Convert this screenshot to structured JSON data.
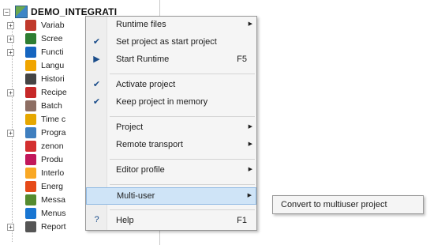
{
  "tree": {
    "root_label": "DEMO_INTEGRATI",
    "items": [
      {
        "label": "Variab",
        "icon": "variables-icon",
        "expandable": true,
        "color": "#c0392b"
      },
      {
        "label": "Scree",
        "icon": "screens-icon",
        "expandable": true,
        "color": "#2e7d32"
      },
      {
        "label": "Functi",
        "icon": "functions-icon",
        "expandable": true,
        "color": "#1565c0"
      },
      {
        "label": "Langu",
        "icon": "languages-icon",
        "expandable": false,
        "color": "#f0a500"
      },
      {
        "label": "Histori",
        "icon": "historian-icon",
        "expandable": false,
        "color": "#444444"
      },
      {
        "label": "Recipe",
        "icon": "recipes-icon",
        "expandable": true,
        "color": "#c62828"
      },
      {
        "label": "Batch",
        "icon": "batch-icon",
        "expandable": false,
        "color": "#8d6e63"
      },
      {
        "label": "Time c",
        "icon": "time-control-icon",
        "expandable": false,
        "color": "#e6a700"
      },
      {
        "label": "Progra",
        "icon": "programming-icon",
        "expandable": true,
        "color": "#3f7fbf"
      },
      {
        "label": "zenon",
        "icon": "zenon-icon",
        "expandable": false,
        "color": "#d32f2f"
      },
      {
        "label": "Produ",
        "icon": "production-icon",
        "expandable": false,
        "color": "#c2185b"
      },
      {
        "label": "Interlo",
        "icon": "interlocking-icon",
        "expandable": false,
        "color": "#f9a825"
      },
      {
        "label": "Energ",
        "icon": "energy-icon",
        "expandable": false,
        "color": "#e64a19"
      },
      {
        "label": "Messa",
        "icon": "message-icon",
        "expandable": false,
        "color": "#558b2f"
      },
      {
        "label": "Menus",
        "icon": "menus-icon",
        "expandable": false,
        "color": "#1976d2"
      },
      {
        "label": "Report",
        "icon": "report-icon",
        "expandable": true,
        "color": "#555555"
      }
    ]
  },
  "context_menu": {
    "items": [
      {
        "label": "Runtime files",
        "shortcut": "",
        "submenu": true,
        "check": "",
        "separator_after": false
      },
      {
        "label": "Set project as start project",
        "shortcut": "",
        "submenu": false,
        "check": "✔",
        "separator_after": false
      },
      {
        "label": "Start Runtime",
        "shortcut": "F5",
        "submenu": false,
        "check": "▶",
        "separator_after": true
      },
      {
        "label": "Activate project",
        "shortcut": "",
        "submenu": false,
        "check": "✔",
        "separator_after": false
      },
      {
        "label": "Keep project in memory",
        "shortcut": "",
        "submenu": false,
        "check": "✔",
        "separator_after": true
      },
      {
        "label": "Project",
        "shortcut": "",
        "submenu": true,
        "check": "",
        "separator_after": false
      },
      {
        "label": "Remote transport",
        "shortcut": "",
        "submenu": true,
        "check": "",
        "separator_after": true
      },
      {
        "label": "Editor profile",
        "shortcut": "",
        "submenu": true,
        "check": "",
        "separator_after": true
      },
      {
        "label": "Multi-user",
        "shortcut": "",
        "submenu": true,
        "check": "",
        "highlighted": true,
        "separator_after": true
      },
      {
        "label": "Help",
        "shortcut": "F1",
        "submenu": false,
        "check": "?",
        "separator_after": false
      }
    ]
  },
  "submenu": {
    "label": "Convert to multiuser project"
  }
}
